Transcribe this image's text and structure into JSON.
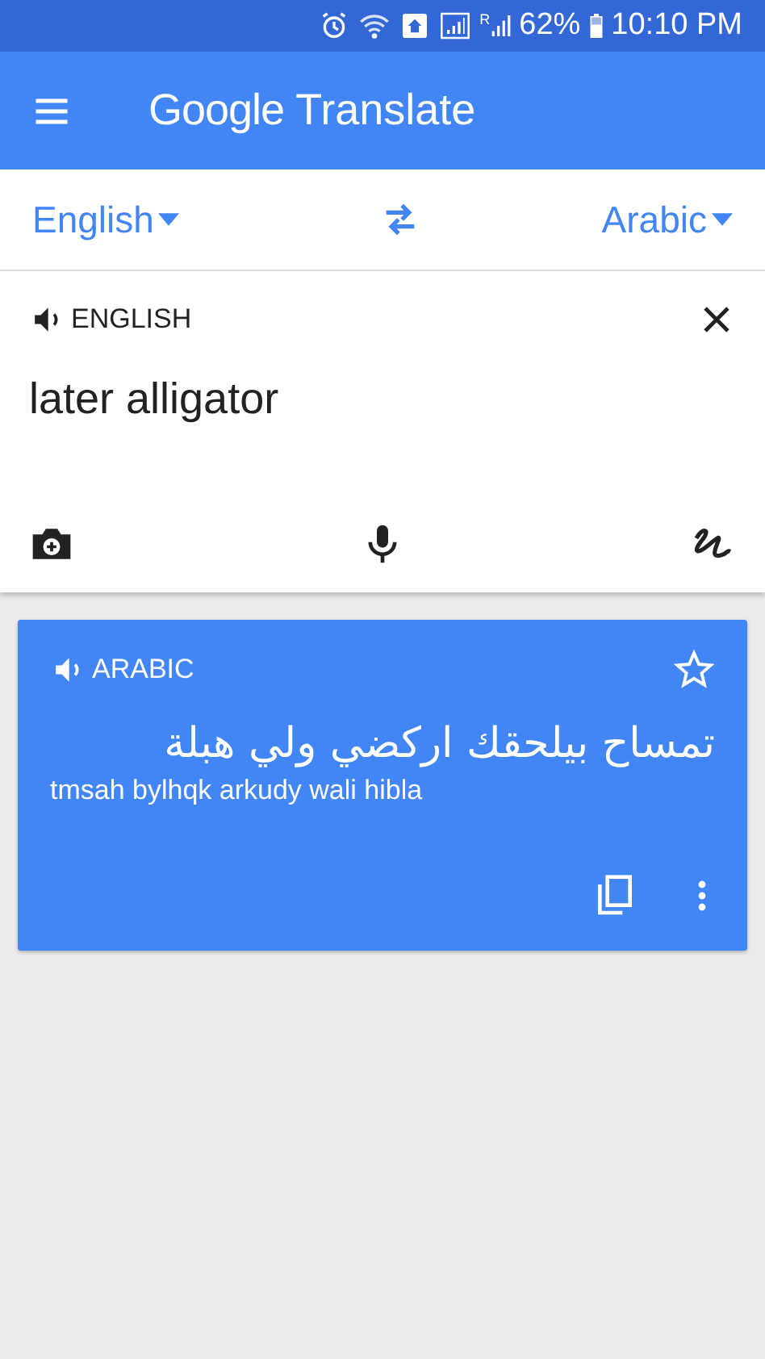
{
  "status_bar": {
    "roaming": "R",
    "battery": "62%",
    "time": "10:10 PM"
  },
  "app_bar": {
    "title_brand": "Google",
    "title_product": "Translate"
  },
  "languages": {
    "source": "English",
    "target": "Arabic"
  },
  "input": {
    "language": "ENGLISH",
    "text": "later alligator"
  },
  "result": {
    "language": "ARABIC",
    "text": "تمساح بيلحقك اركضي ولي هبلة",
    "transliteration": "tmsah bylhqk arkudy wali hibla",
    "starred": false
  }
}
